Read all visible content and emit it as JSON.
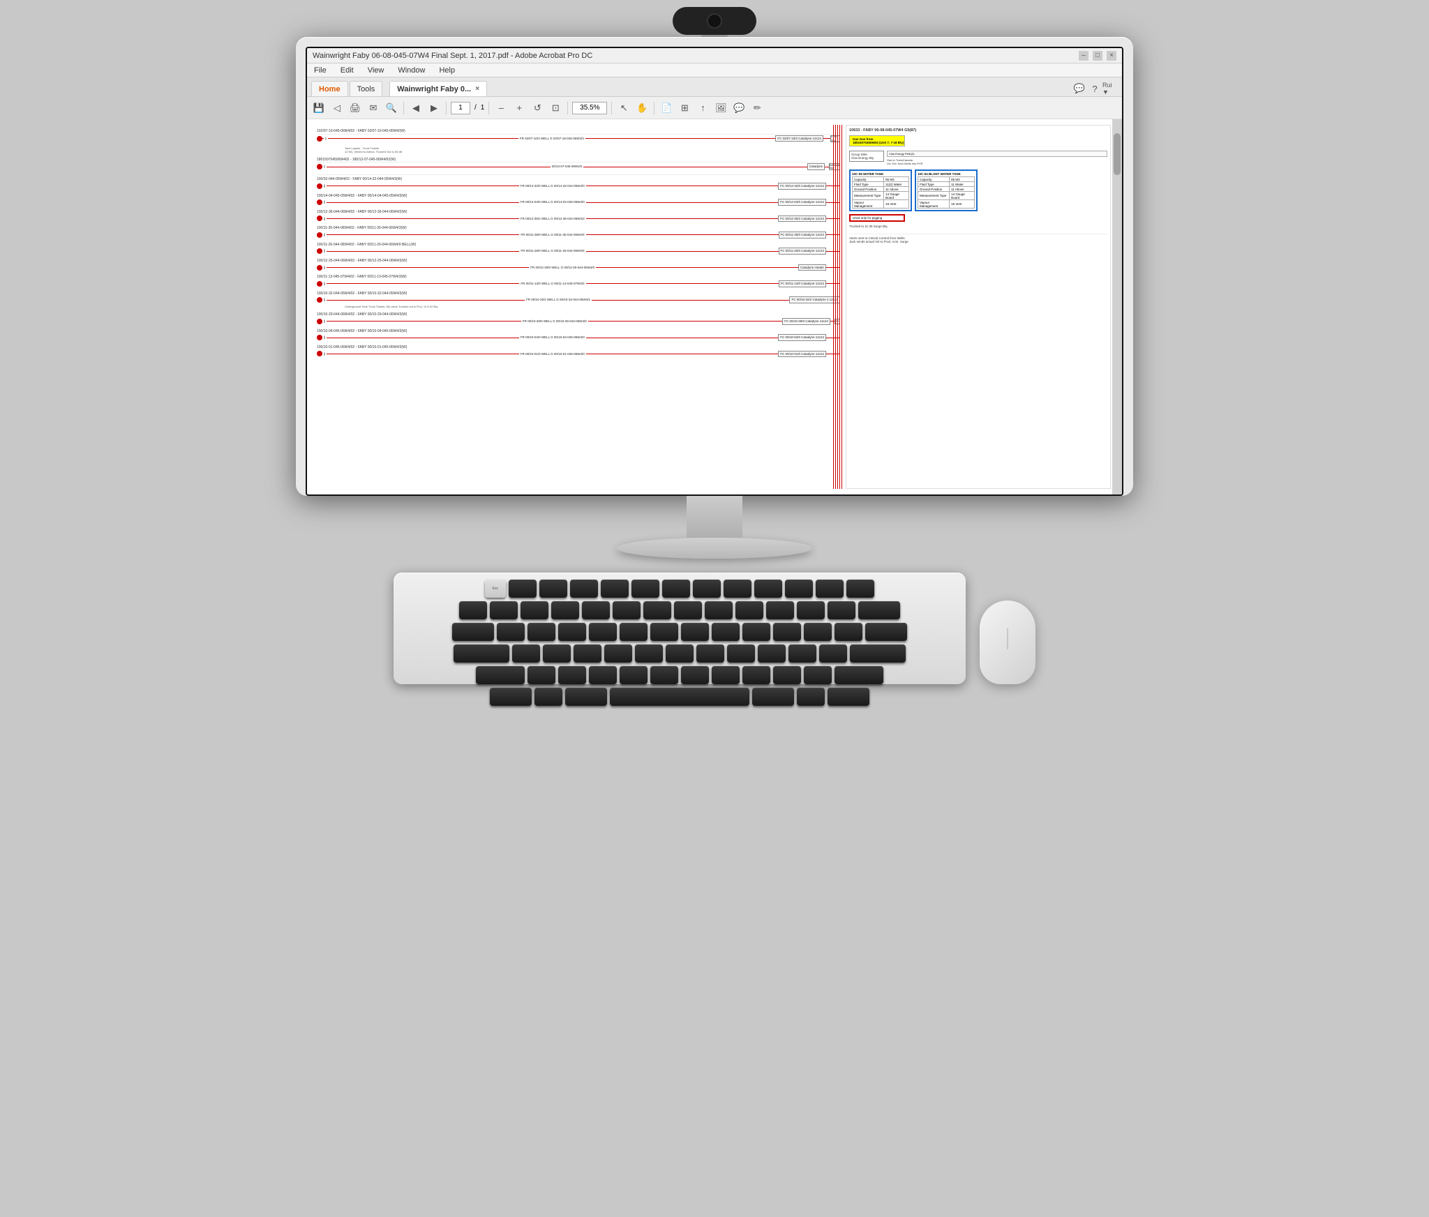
{
  "monitor": {
    "title_bar": "Wainwright Faby 06-08-045-07W4 Final Sept. 1, 2017.pdf - Adobe Acrobat Pro DC",
    "window_controls": [
      "–",
      "□",
      "×"
    ],
    "menu_items": [
      "File",
      "Edit",
      "View",
      "Window",
      "Help"
    ],
    "tabs": {
      "home_label": "Home",
      "tools_label": "Tools",
      "doc_tab_label": "Wainwright Faby 0...",
      "active": "doc"
    },
    "toolbar": {
      "zoom_value": "35.5%",
      "page_current": "1",
      "page_total": "1"
    },
    "right_toolbar_icons": [
      "💬",
      "?",
      "Rui"
    ]
  },
  "pdf": {
    "left_rows": [
      "102/07-10-045-06W4/02 - FABY 02/07-10-045-06W4/3(W)",
      "102/07-18-045-06W4/02 G   FR 02/07-10/3 WELL G 02/07-18-045-06W4/3   FC 02/07-18/3 Catadyne 12c24   2 Ph Sep.",
      "180150704506W402 - 180/13-07-045-06W4/02(W)",
      "180150704506W402 G   00/13-07-045-06W4/2   Catadyne   SuiteCase Sep.",
      "100/32-044-05W4/02 - FABY 00/14-32-044-05W4/3(W)",
      "100/14-32-044-05W4/02 G   FR 00/14-32/0 WELL G 00/14-32-044-05W4/0   FC 00/14-32/0 Catadyne 12c24",
      "100/14-04-045-05W4/02 - FABY 00/14-04-045-05W4/3(W)",
      "100/14-04-045-05W4/02 G   FR 00/14-04/0 WELL G 00/14-04-045-05W4/0   FC 00/14-04/0 Catadyne 12c24",
      "100/12-36-044-06W4/02 - FABY 00/12-36-044-06W4/2(W)",
      "100/12-36-044-06W4/02 G   FR 00/12-36/2 WELL G 00/12-36-044-06W4/2   FC 00/12-36/2 Catadyne 12c24",
      "100/11-35-044-06W4/02 - FABY 00/11-35-044-06W4/3(W)",
      "100/11-35-044-06W4/02 G   FR 00/11-35/0 WELL G 00/11-35-044-06W4/0   FC 00/11-35/0 Catadyne 13c24",
      "100/11-26-044-06W4/02 - FABY 00/11-26-044-06W4/0 BELL(W)",
      "100/11-26-044-06W4/02 G   FR 00/11-26/0 WELL G 00/11-26-044-06W4/0   FC 00/11-26/0 Catadyne 12c24",
      "100/12-25-044-06W4/02 - FABY 00/12-25-044-06W4/3(W)",
      "100/12-25-044-06W4/02 G   FR 00/12-25/0 WELL G 00/12-25-044-06W4/0   Catadyne Heater",
      "100/11-13-045-07W4/02 - FABY 00/11-13-045-07W4/3(W)",
      "100/11-13-045-07W4/02 G   FR 00/11-13/0 WELL G 00/11-13-045-07W4/0   FC 00/11-13/0 Catadyne 12c24",
      "100/10-32-044-05W4/02 - FABY 00/10-32-044-05W4/3(W)",
      "100/10-32-044-05W4/02 G   FR 00/10-32/2 WELL G 00/10-32-044-05W4/2   FC 00/10-32/2 Catadyne 2 12c24   Underground Tank   Truck Tickets, Dip stock   Trucked out to Proj. 12 8-32 Bty",
      "100/10-29-044-06W4/02 - FABY 00/10-29-044-06W4/3(W)",
      "100/10-29-044-06W4/02 G   FR 00/10-29/0 WELL G 00/10-29-044-06W4/0   FC 00/10-29/0 Catadyne 12c24   Sep.",
      "100/10-04-045-06W4/02 - FABY 00/10-04-045-06W4/3(W)",
      "100/10-04-045-06W4/02 G   FR 00/10-04/0 WELL G 00/10-04-045-06W4/0   FC 00/10-04/0 Catadyne 12c24",
      "100/10-01-045-06W4/02 - FABY 00/10-01-045-06W4/3(W)",
      "100/10-01-045-06W4/02 G   FR 00/10-01/0 WELL G 00/10-01-045-06W4/0   FC 00/10-01/0 Catadyne 12c24"
    ],
    "right_panel": {
      "title": "10633 - FABY 06-08-045-07W4 G5(87)",
      "incoming_label": "Gas Gas from\n180150704506W4 (Unit 7, 7-18 Bty)",
      "group_dilet_label": "Group Dilet\nClas Energy Bty",
      "water_tank_title": "10C-04 BLANT WATER TANK",
      "water_tank_fields": {
        "Capacity": "85 M3",
        "Fluid Type": "11 Water",
        "Ground Position": "11 Above",
        "Measurement Type": "14 Gauge Board",
        "Vapour Management": "15 Vent"
      },
      "gas_tank_title": "10C-05 WATER TANK",
      "gas_tank_fields": {
        "Capacity": "85 M3",
        "Fluid Type": "11(2) Water",
        "Ground Position": "11 Above",
        "Measurement Type": "14 Gauge Board",
        "Vapour Management": "15 Vent"
      },
      "red_box_label": "Used only for pigging",
      "trucked_label": "Trucked to 11-35 Surge Bty.",
      "gas_to_trans": "Gas to TransCanada\nVol. Est. from Wells into PVR",
      "clas_label": "Clas Energy PetK(2)",
      "alerts_label": "Alerts sent to Critical Control from Wells.\nJack sends actual Vol to Prod. Actn. Surge"
    }
  },
  "icons": {
    "save": "💾",
    "print": "🖨",
    "envelope": "✉",
    "search": "🔍",
    "back": "◀",
    "forward": "▶",
    "zoom_out": "—",
    "zoom_in": "+",
    "cursor": "↖",
    "hand": "✋",
    "comment": "💬",
    "help": "?",
    "page": "📄",
    "sign": "✏",
    "tools": "🔧"
  }
}
